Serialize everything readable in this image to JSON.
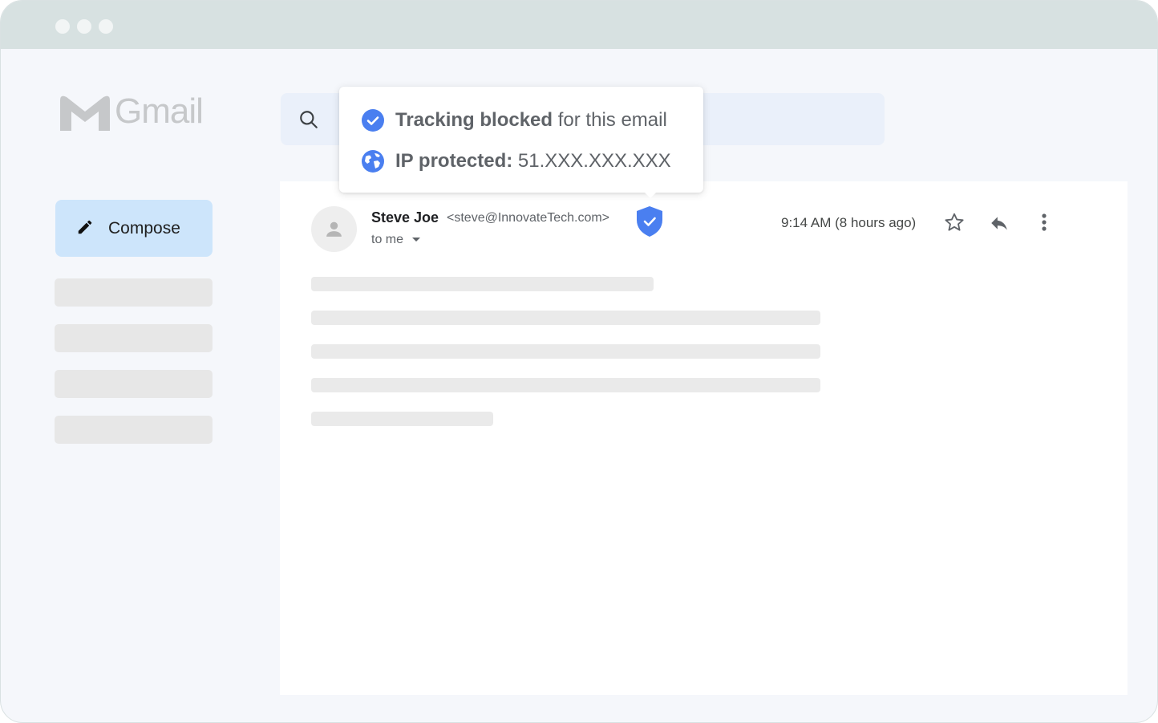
{
  "window": {
    "traffic_lights": [
      "close",
      "minimize",
      "maximize"
    ]
  },
  "app": {
    "logo_text": "Gmail",
    "logo_icon": "gmail-m-icon"
  },
  "sidebar": {
    "compose_label": "Compose",
    "compose_icon": "pencil-icon",
    "placeholder_items": 4
  },
  "search": {
    "icon": "search-icon"
  },
  "email": {
    "sender_name": "Steve Joe",
    "sender_email": "<steve@InnovateTech.com>",
    "recipient": "to me",
    "time": "9:14 AM",
    "relative_time": "(8 hours ago)",
    "badge_icon": "shield-check-icon",
    "actions": [
      "star-icon",
      "reply-icon",
      "more-vert-icon"
    ],
    "body_placeholder_lines": 5
  },
  "popup": {
    "tracking_bold": "Tracking blocked",
    "tracking_rest": " for this email",
    "ip_bold": "IP protected:",
    "ip_value": " 51.XXX.XXX.XXX",
    "check_icon": "check-circle-icon",
    "globe_icon": "globe-icon"
  },
  "colors": {
    "accent_blue": "#4a7ff0",
    "compose_bg": "#cde5fb",
    "titlebar": "#d7e1e1"
  }
}
